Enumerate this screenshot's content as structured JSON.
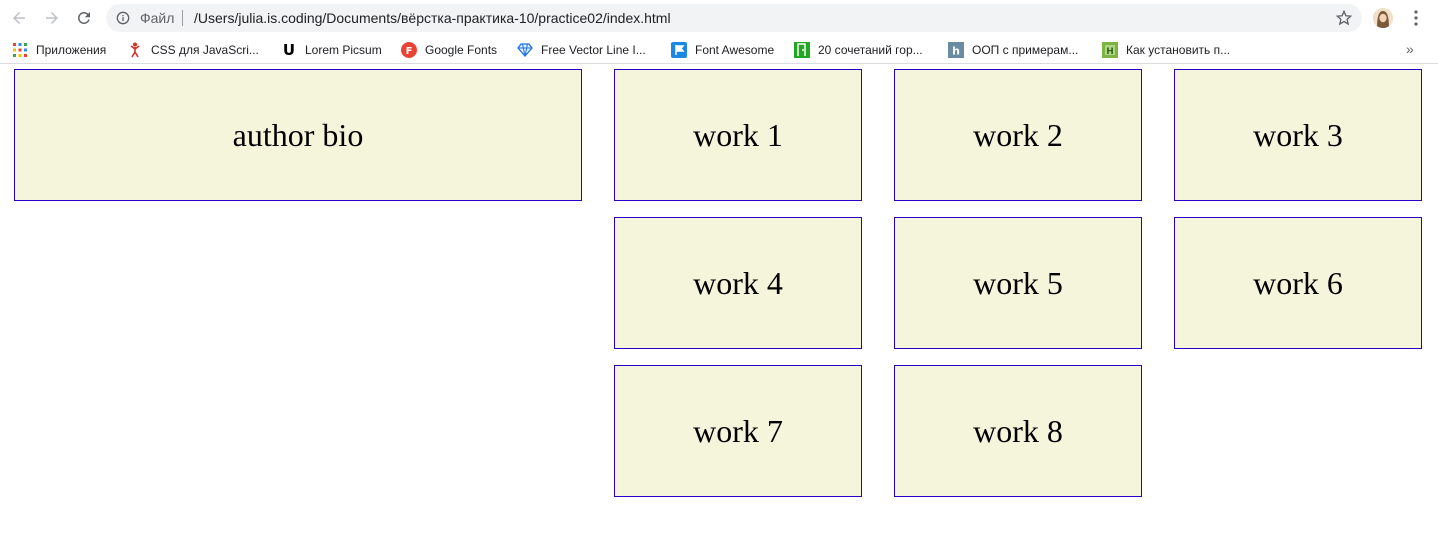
{
  "browser": {
    "file_label": "Файл",
    "url": "/Users/julia.is.coding/Documents/вёрстка-практика-10/practice02/index.html"
  },
  "bookmarks": [
    {
      "label": "Приложения",
      "icon": "apps-grid-icon"
    },
    {
      "label": "CSS для JavaScri...",
      "icon": "css-figure-icon"
    },
    {
      "label": "Lorem Picsum",
      "icon": "lorem-picsum-icon"
    },
    {
      "label": "Google Fonts",
      "icon": "google-fonts-icon"
    },
    {
      "label": "Free Vector Line I...",
      "icon": "diamond-icon"
    },
    {
      "label": "Font Awesome",
      "icon": "flag-icon"
    },
    {
      "label": "20 сочетаний гор...",
      "icon": "door-icon"
    },
    {
      "label": "ООП с примерам...",
      "icon": "habr-icon"
    },
    {
      "label": "Как установить п...",
      "icon": "h-green-icon"
    }
  ],
  "page": {
    "bio": "author bio",
    "works": [
      "work 1",
      "work 2",
      "work 3",
      "work 4",
      "work 5",
      "work 6",
      "work 7",
      "work 8"
    ]
  },
  "colors": {
    "box_bg": "#f5f5dc",
    "box_border": "#2a00c8"
  }
}
